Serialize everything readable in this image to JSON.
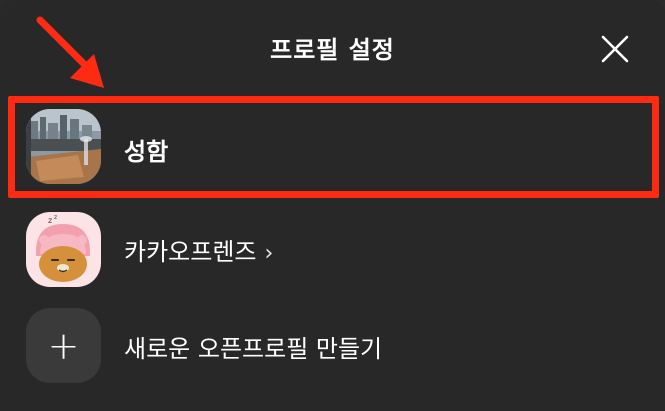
{
  "header": {
    "title": "프로필 설정",
    "close_icon": "close-icon"
  },
  "annotation": {
    "arrow_color": "#ff2a12",
    "highlight_color": "#ff2a12"
  },
  "profiles": [
    {
      "label": "성함",
      "icon": "profile-photo"
    },
    {
      "label": "카카오프렌즈",
      "chevron": "›",
      "icon": "ryan-character"
    },
    {
      "label": "새로운 오픈프로필 만들기",
      "icon": "plus-icon",
      "plus": "+"
    }
  ],
  "colors": {
    "background": "#282828",
    "text": "#ffffff",
    "accent": "#ff2a12"
  }
}
